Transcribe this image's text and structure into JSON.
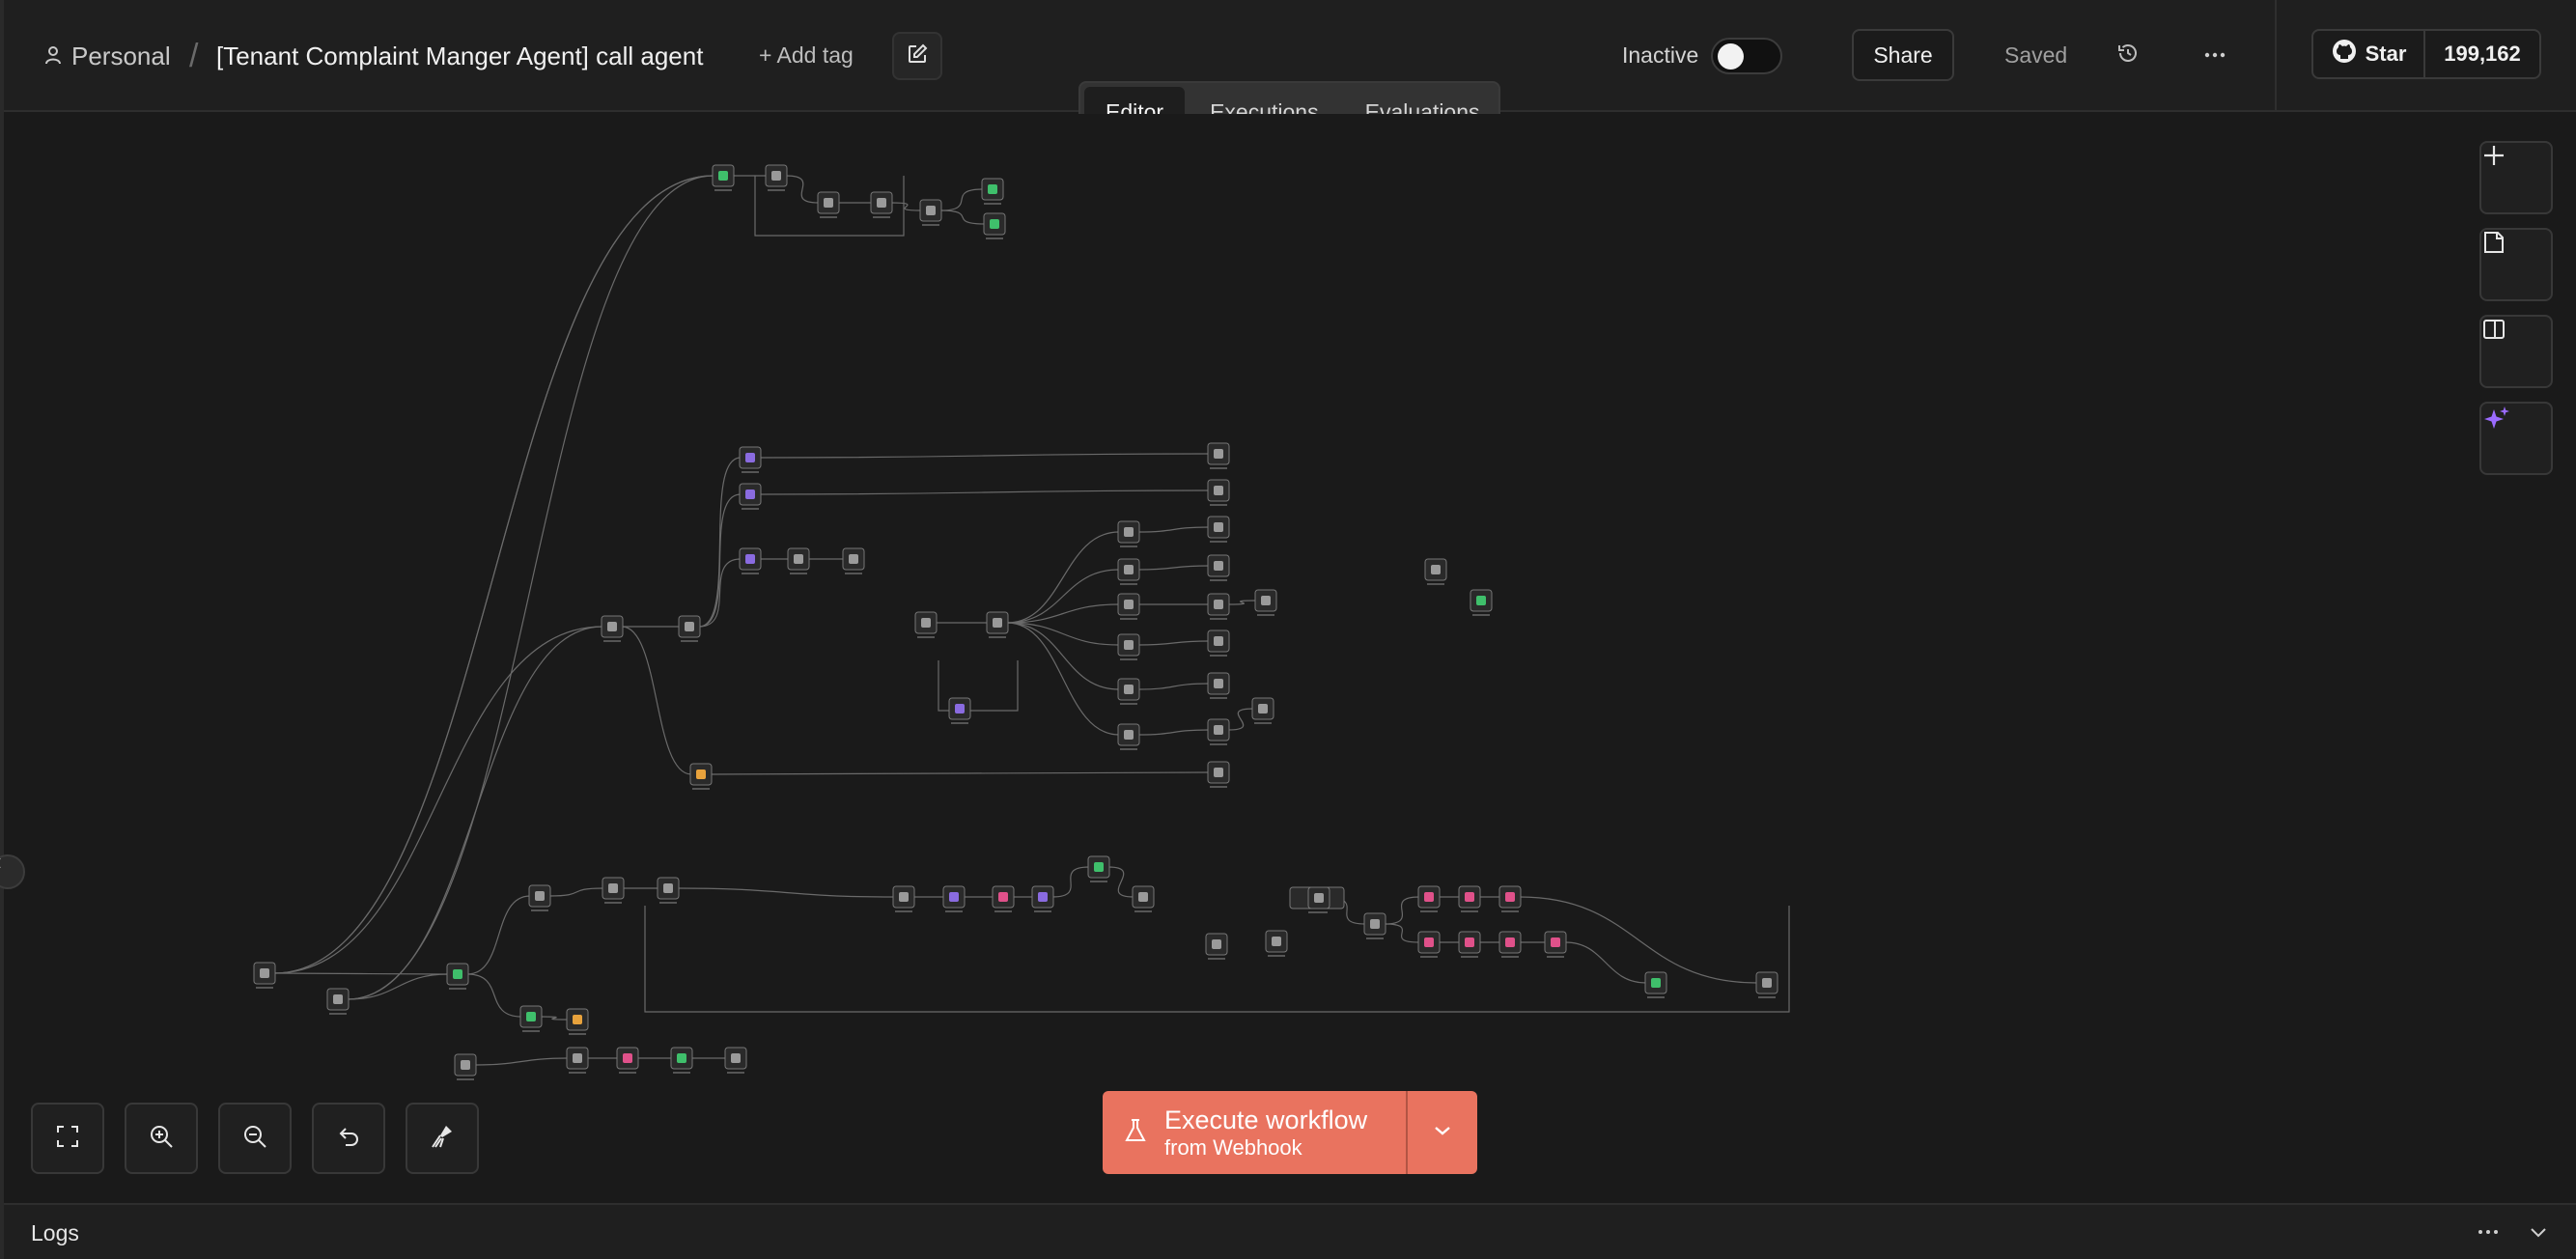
{
  "header": {
    "breadcrumb_project": "Personal",
    "separator": "/",
    "workflow_title": "[Tenant Complaint Manger Agent] call agent",
    "add_tag": "+ Add tag",
    "status_label": "Inactive",
    "active": false,
    "share_label": "Share",
    "saved_label": "Saved",
    "github_star_label": "Star",
    "github_star_count": "199,162"
  },
  "tabs": [
    {
      "label": "Editor",
      "active": true
    },
    {
      "label": "Executions",
      "active": false
    },
    {
      "label": "Evaluations",
      "active": false
    }
  ],
  "execute": {
    "title": "Execute workflow",
    "subtitle": "from Webhook"
  },
  "logs": {
    "label": "Logs"
  },
  "right_toolbar": [
    "plus-icon",
    "sticky-note-icon",
    "panel-icon",
    "ai-sparkle-icon"
  ],
  "bottom_toolbar": [
    "fit-view-icon",
    "zoom-in-icon",
    "zoom-out-icon",
    "undo-icon",
    "clean-up-icon"
  ],
  "colors": {
    "accent": "#e9735f",
    "canvas": "#1a1a1a",
    "node_green": "#3fbf6b",
    "node_pink": "#e0518a",
    "node_purple": "#8a6be0",
    "node_orange": "#e8a23c"
  }
}
